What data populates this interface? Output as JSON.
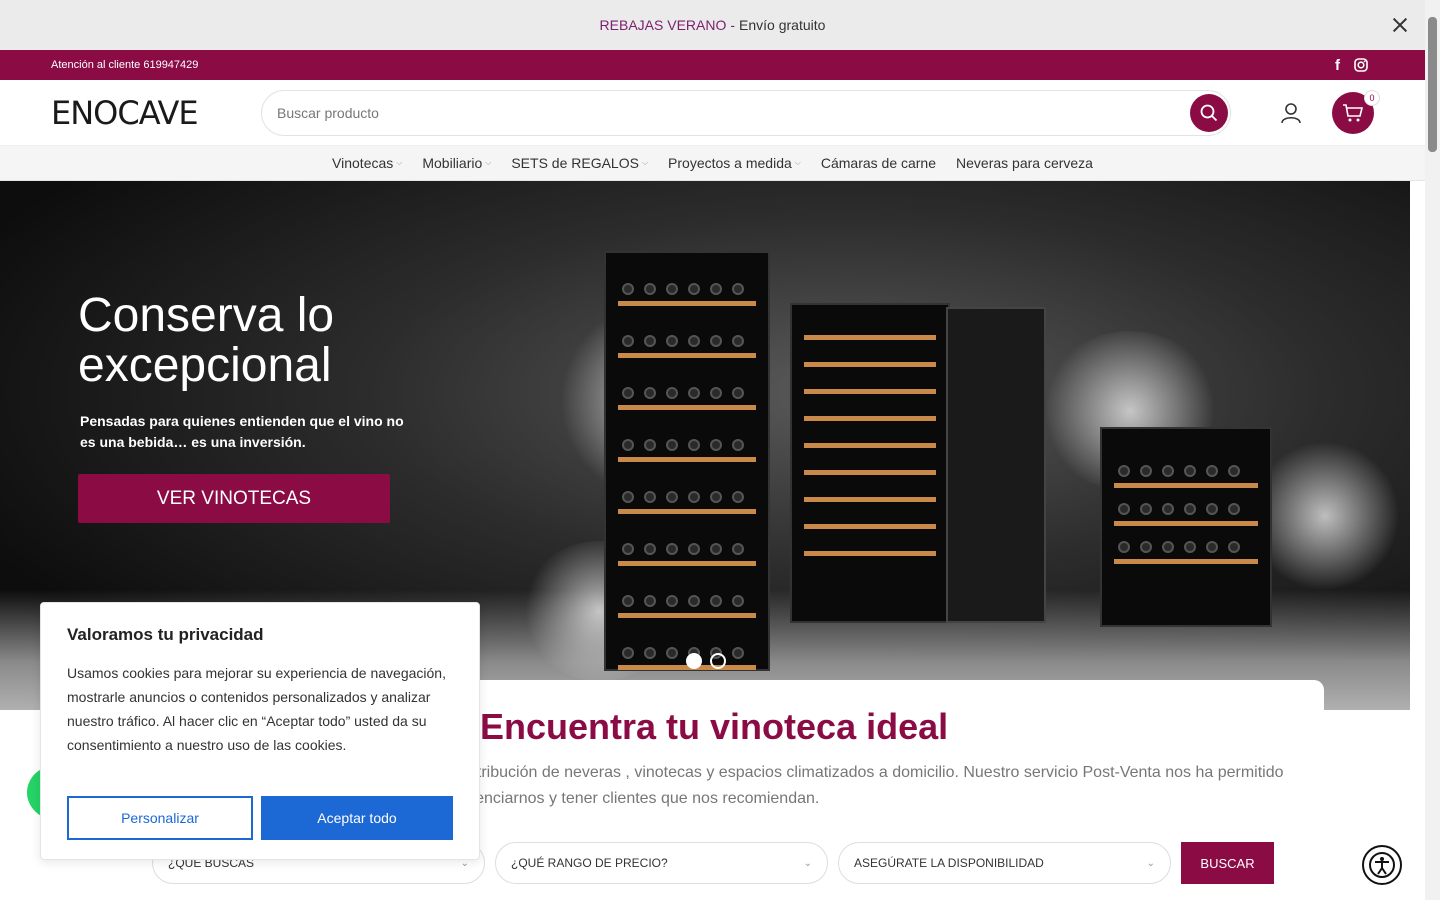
{
  "promo": {
    "highlight": "REBAJAS VERANO",
    "separator": "-",
    "rest": "Envío gratuito"
  },
  "topbar": {
    "contact": "Atención al cliente 619947429",
    "social_icons": [
      "facebook-icon",
      "instagram-icon"
    ]
  },
  "header": {
    "logo": "ENOCAVE",
    "search_placeholder": "Buscar producto",
    "cart_count": "0"
  },
  "nav": {
    "items": [
      {
        "label": "Vinotecas",
        "has_dropdown": true
      },
      {
        "label": "Mobiliario",
        "has_dropdown": true
      },
      {
        "label": "SETS de REGALOS",
        "has_dropdown": true
      },
      {
        "label": "Proyectos a medida",
        "has_dropdown": true
      },
      {
        "label": "Cámaras de carne",
        "has_dropdown": false
      },
      {
        "label": "Neveras para cerveza",
        "has_dropdown": false
      }
    ]
  },
  "hero": {
    "title": "Conserva lo excepcional",
    "subtitle": "Pensadas para quienes entienden que el vino no es una bebida… es una inversión.",
    "button": "VER VINOTECAS",
    "slide_count": 2,
    "active_slide": 1
  },
  "finder": {
    "title": "Encuentra tu vinoteca ideal",
    "text": "y distribución de neveras , vinotecas y espacios climatizados a domicilio. Nuestro servicio Post-Venta nos ha permitido diferenciarnos y tener clientes que nos recomiendan.",
    "selects": [
      "¿QUE BUSCAS",
      "¿QUÉ RANGO DE PRECIO?",
      "ASEGÚRATE LA DISPONIBILIDAD"
    ],
    "button": "BUSCAR"
  },
  "cookie": {
    "title": "Valoramos tu privacidad",
    "text": "Usamos cookies para mejorar su experiencia de navegación, mostrarle anuncios o contenidos personalizados y analizar nuestro tráfico. Al hacer clic en “Aceptar todo” usted da su consentimiento a nuestro uso de las cookies.",
    "customize": "Personalizar",
    "accept": "Aceptar todo"
  },
  "colors": {
    "brand": "#8b0c45",
    "cookie_primary": "#1c68d5",
    "whatsapp": "#25d366"
  }
}
